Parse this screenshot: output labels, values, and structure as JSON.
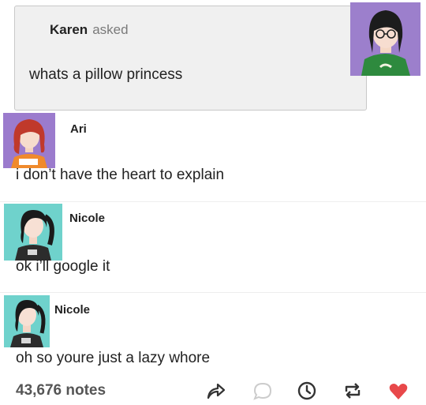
{
  "ask": {
    "asker": "Karen",
    "verb": "asked",
    "question": "whats a pillow princess"
  },
  "replies": [
    {
      "name": "Ari",
      "text": "i don’t have the heart to explain"
    },
    {
      "name": "Nicole",
      "text": "ok i’ll google it"
    },
    {
      "name": "Nicole",
      "text": "oh so youre just a lazy whore"
    }
  ],
  "footer": {
    "notes": "43,676 notes"
  },
  "icons": {
    "share": "share-icon",
    "reply": "reply-bubble-icon",
    "queue": "clock-icon",
    "reblog": "reblog-icon",
    "like": "heart-icon"
  },
  "colors": {
    "like": "#e8484a",
    "icon": "#333333",
    "reply_icon": "#cccccc",
    "avatar_purple": "#9c7fcc",
    "avatar_teal": "#6fd2cc"
  }
}
